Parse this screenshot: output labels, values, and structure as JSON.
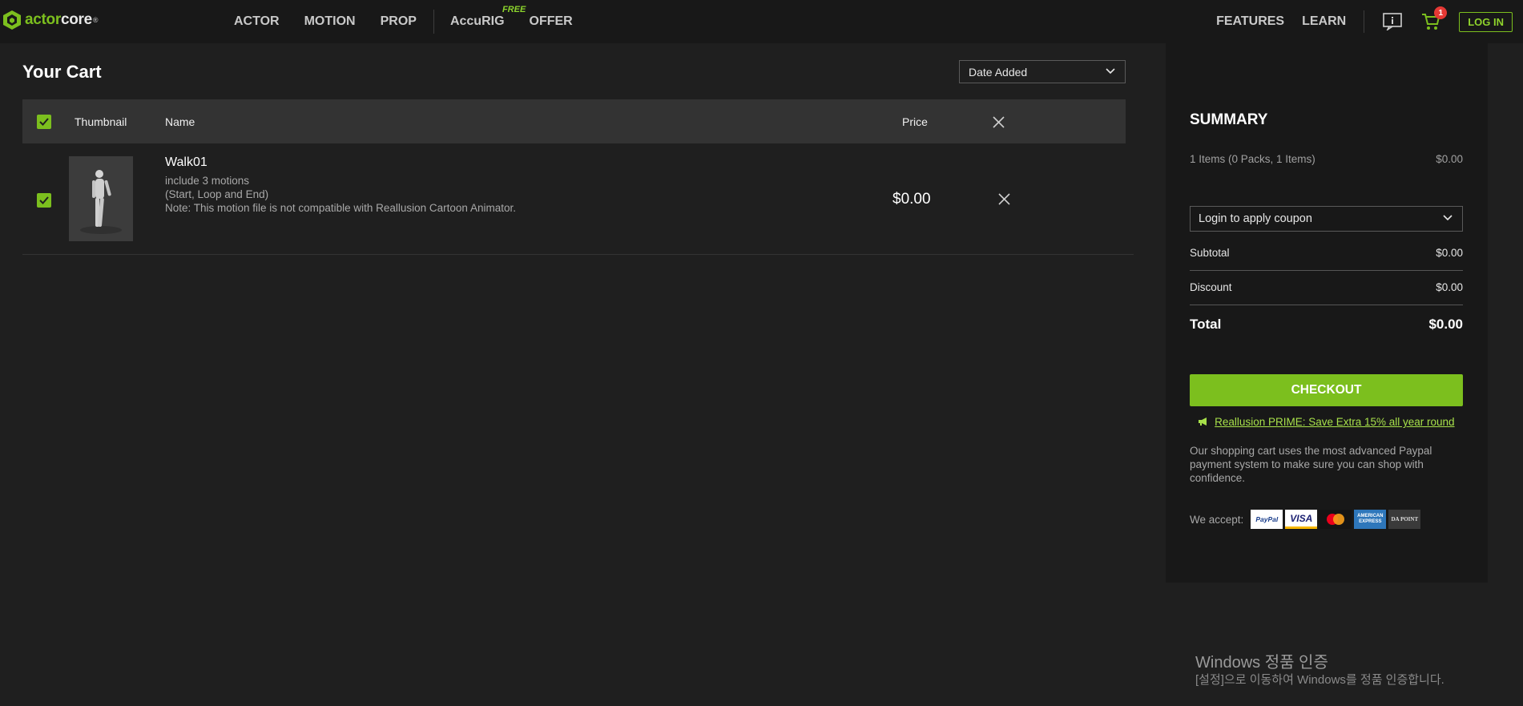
{
  "brand": {
    "part1": "actor",
    "part2": "core",
    "reg": "®"
  },
  "nav": {
    "main": [
      "ACTOR",
      "MOTION",
      "PROP"
    ],
    "accurig": "AccuRIG",
    "accurig_badge": "FREE",
    "offer": "OFFER",
    "right": [
      "FEATURES",
      "LEARN"
    ],
    "cart_count": "1",
    "login": "LOG IN"
  },
  "cart": {
    "title": "Your Cart",
    "sort_selected": "Date Added",
    "columns": {
      "thumbnail": "Thumbnail",
      "name": "Name",
      "price": "Price"
    },
    "items": [
      {
        "name": "Walk01",
        "desc1": "include 3 motions",
        "desc2": "(Start, Loop and End)",
        "desc3": "Note: This motion file is not compatible with Reallusion Cartoon Animator.",
        "price": "$0.00",
        "checked": true
      }
    ]
  },
  "summary": {
    "title": "SUMMARY",
    "items_label": "1 Items (0 Packs, 1 Items)",
    "items_value": "$0.00",
    "coupon": "Login to apply coupon",
    "subtotal_label": "Subtotal",
    "subtotal_value": "$0.00",
    "discount_label": "Discount",
    "discount_value": "$0.00",
    "total_label": "Total",
    "total_value": "$0.00",
    "checkout": "CHECKOUT",
    "prime_link": "Reallusion PRIME: Save Extra 15% all year round",
    "paypal_note": "Our shopping cart uses the most advanced Paypal payment system to make sure you can shop with confidence.",
    "accept_label": "We accept:",
    "cards": [
      "PayPal",
      "VISA",
      "mastercard",
      "AMERICAN EXPRESS",
      "DA POINT"
    ]
  },
  "watermark": {
    "line1": "Windows 정품 인증",
    "line2": "[설정]으로 이동하여 Windows를 정품 인증합니다."
  },
  "colors": {
    "accent": "#7cbf1e",
    "background": "#1f1f1f",
    "panel": "#181818",
    "header_row": "#333333"
  }
}
